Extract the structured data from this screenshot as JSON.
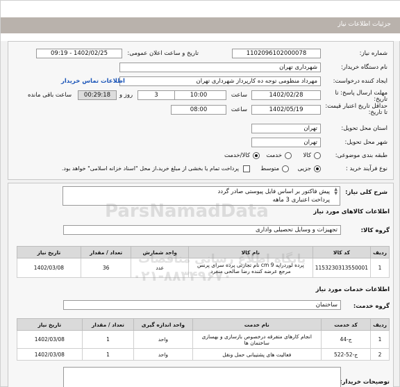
{
  "header": {
    "title": "جزئیات اطلاعات نیاز"
  },
  "form": {
    "need_number": {
      "label": "شماره نیاز:",
      "value": "1102096102000078"
    },
    "announce_date": {
      "label": "تاریخ و ساعت اعلان عمومی:",
      "value": "1402/02/25 - 09:19"
    },
    "buyer_org": {
      "label": "نام دستگاه خریدار:",
      "value": "شهرداری تهران"
    },
    "requester": {
      "label": "ایجاد کننده درخواست:",
      "value": "مهرداد منظومی توجه ده کارپرداز شهرداری تهران",
      "contact_link": "اطلاعات تماس خریدار"
    },
    "reply_deadline": {
      "label": "مهلت ارسال پاسخ: تا تاریخ:",
      "date": "1402/02/28",
      "time_label": "ساعت",
      "time": "10:00",
      "days": "3",
      "days_label": "روز و",
      "remaining": "00:29:18",
      "remaining_label": "ساعت باقی مانده"
    },
    "price_validity": {
      "label": "حداقل تاریخ اعتبار قیمت: تا تاریخ:",
      "date": "1402/05/19",
      "time_label": "ساعت",
      "time": "08:00"
    },
    "province": {
      "label": "استان محل تحویل:",
      "value": "تهران"
    },
    "city": {
      "label": "شهر محل تحویل:",
      "value": "تهران"
    },
    "category": {
      "label": "طبقه بندی موضوعی:",
      "options": [
        "کالا",
        "خدمت",
        "کالا/خدمت"
      ],
      "selected": "کالا/خدمت"
    },
    "purchase_type": {
      "label": "نوع فرآیند خرید :",
      "options": [
        "جزیی",
        "متوسط"
      ],
      "selected": "جزیی",
      "note": "پرداخت تمام یا بخشی از مبلغ خرید،از محل \"اسناد خزانه اسلامی\" خواهد بود."
    }
  },
  "summary": {
    "label": "شرح کلی نیاز:",
    "lines": [
      "پیش فاکتور بر اساس فایل پیوستی صادر گردد",
      "پرداخت اعتباری 3 ماهه"
    ]
  },
  "goods": {
    "section_title": "اطلاعات کالاهای مورد نیاز",
    "group_label": "گروه کالا:",
    "group_value": "تجهیزات و وسایل تحصیلی واداری",
    "columns": [
      "ردیف",
      "کد کالا",
      "نام کالا",
      "واحد شمارش",
      "تعداد / مقدار",
      "تاریخ نیاز"
    ],
    "rows": [
      [
        "1",
        "1153230313550001",
        "پرده لوردراپه cm 9 نام تجارتی پرده سرای پرنس مرجع عرضه کننده رضا صالحی منفرد",
        "عدد",
        "36",
        "1402/03/08"
      ]
    ]
  },
  "services": {
    "section_title": "اطلاعات خدمات مورد نیاز",
    "group_label": "گروه خدمت:",
    "group_value": "ساختمان",
    "columns": [
      "ردیف",
      "کد خدمت",
      "نام خدمت",
      "واحد اندازه گیری",
      "تعداد / مقدار",
      "تاریخ نیاز"
    ],
    "rows": [
      [
        "1",
        "ج-44",
        "انجام کارهای متفرقه درخصوص بازسازی و بهسازی ساختمان ها",
        "واحد",
        "1",
        "1402/03/08"
      ],
      [
        "2",
        "ج-52-522",
        "فعالیت های پشتیبانی حمل ونقل",
        "واحد",
        "1",
        "1402/03/08"
      ]
    ]
  },
  "buyer_notes": {
    "label": "توضیحات خریدار:"
  },
  "watermark": {
    "line1": "ParsNamadData",
    "line2": "پایگاه اطلاع رسانی مناقصات",
    "phone": "۰۲۱-۸۸۳۴۹۶۷۰"
  }
}
